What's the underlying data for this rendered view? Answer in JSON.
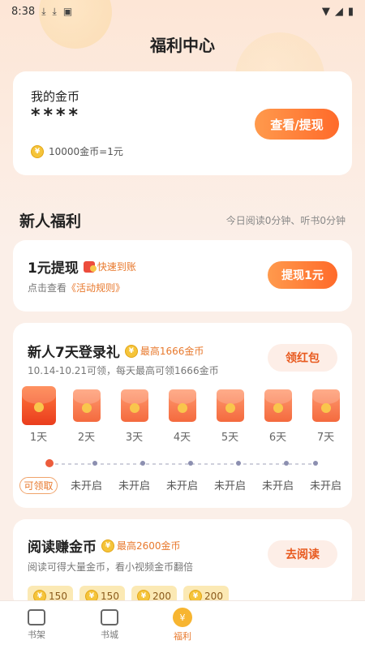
{
  "status_bar": {
    "time": "8:38"
  },
  "page_title": "福利中心",
  "coins_card": {
    "label": "我的金币",
    "value": "****",
    "button": "查看/提现",
    "rate": "10000金币=1元"
  },
  "section": {
    "title": "新人福利",
    "sub": "今日阅读0分钟、听书0分钟"
  },
  "withdraw": {
    "title": "1元提现",
    "tag": "快速到账",
    "desc_prefix": "点击查看",
    "desc_link": "《活动规则》",
    "button": "提现1元"
  },
  "login": {
    "title": "新人7天登录礼",
    "tag": "最高1666金币",
    "desc": "10.14-10.21可领，每天最高可领1666金币",
    "button": "领红包",
    "days": [
      "1天",
      "2天",
      "3天",
      "4天",
      "5天",
      "6天",
      "7天"
    ],
    "statuses": [
      "可领取",
      "未开启",
      "未开启",
      "未开启",
      "未开启",
      "未开启",
      "未开启"
    ]
  },
  "reading": {
    "title": "阅读赚金币",
    "tag": "最高2600金币",
    "desc": "阅读可得大量金币，看小视频金币翻倍",
    "button": "去阅读",
    "chips": [
      "150",
      "150",
      "200",
      "200"
    ]
  },
  "tabs": [
    "书架",
    "书城",
    "福利"
  ],
  "colors": {
    "accent": "#ff6a2a",
    "gold": "#f5c43a",
    "background": "#fbefe8"
  }
}
